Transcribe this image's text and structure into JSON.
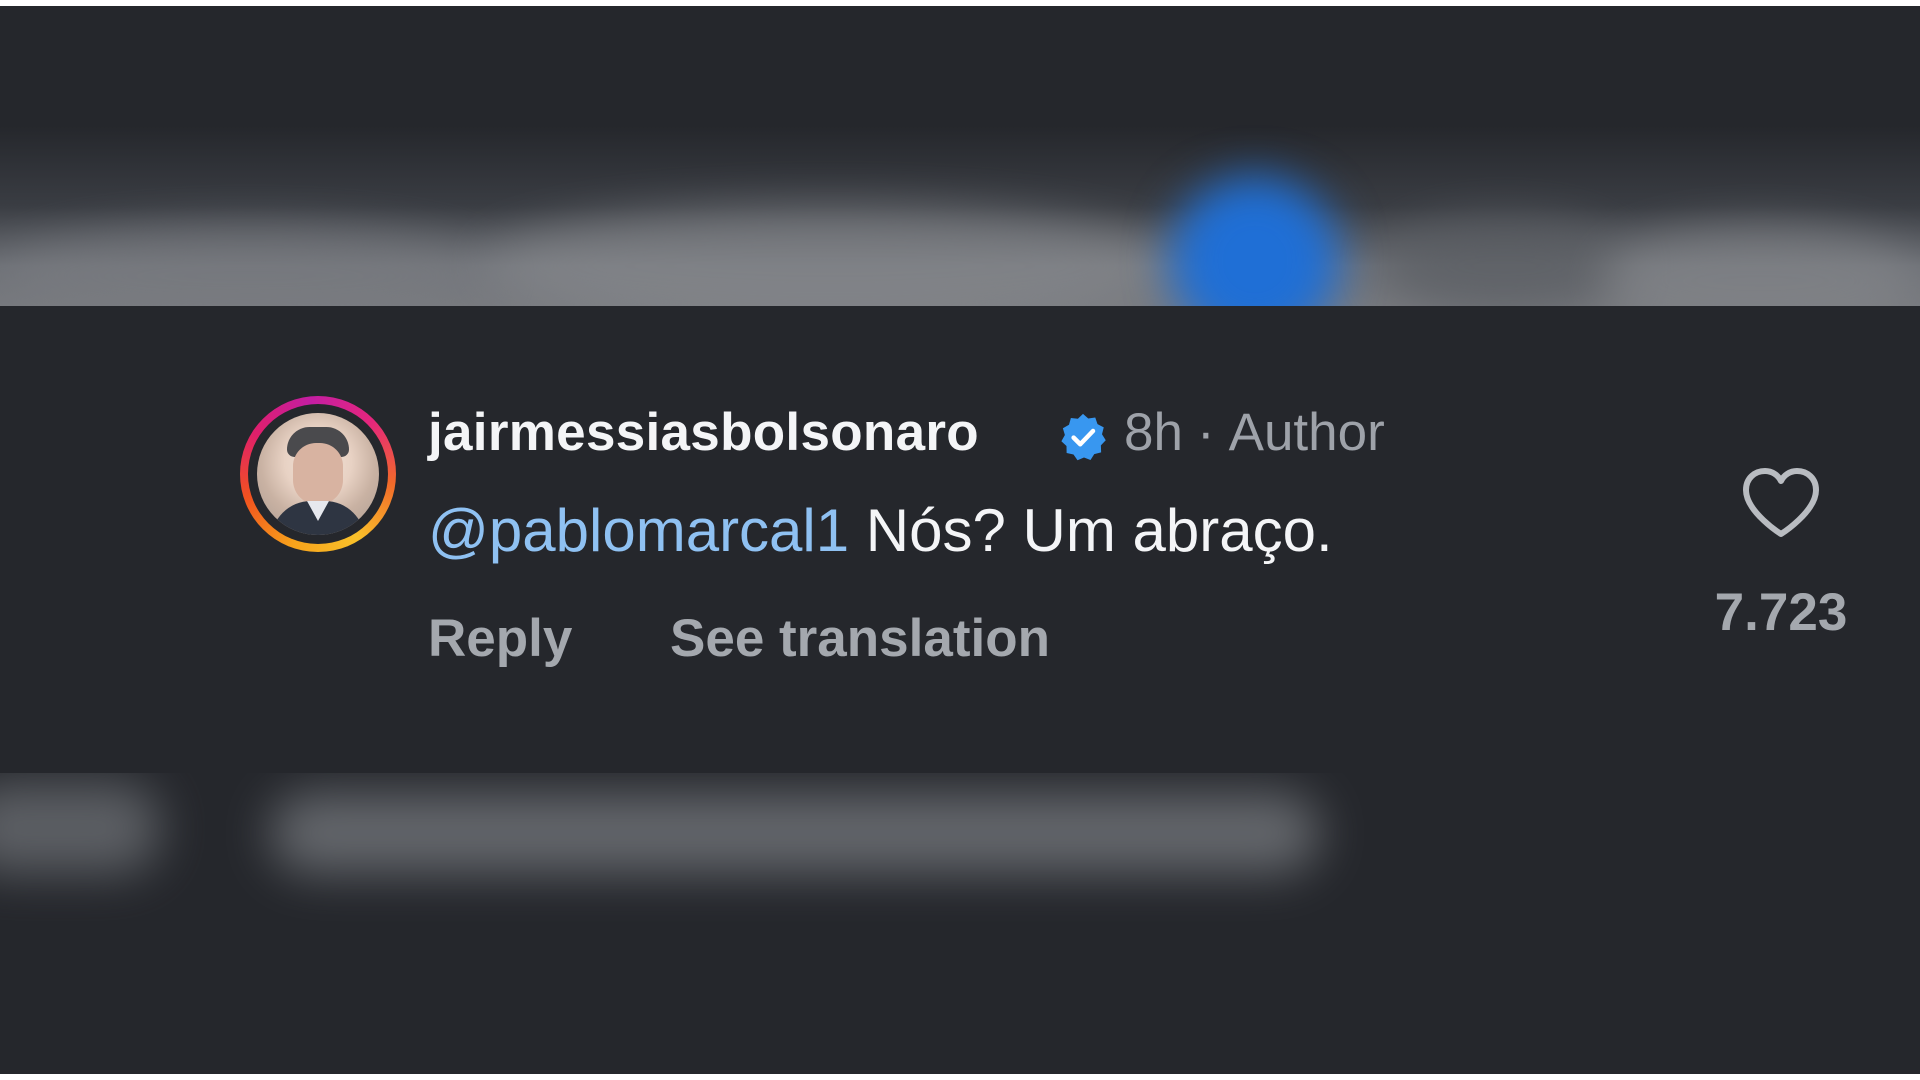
{
  "comment": {
    "username": "jairmessiasbolsonaro",
    "verified": true,
    "time": "8h",
    "separator": "·",
    "author_label": "Author",
    "mention": "@pablomarcal1",
    "text": "Nós? Um abraço.",
    "actions": {
      "reply_label": "Reply",
      "translate_label": "See translation"
    },
    "likes": {
      "count": "7.723",
      "icon": "heart-outline-icon"
    },
    "avatar": {
      "icon": "profile-photo"
    }
  },
  "colors": {
    "background": "#25272c",
    "username": "#f4f5f7",
    "mention": "#8fc1f2",
    "muted_text": "#9ea2a9",
    "verified_badge": "#3897f0",
    "story_ring": [
      "#f9c12a",
      "#f26a2a",
      "#e01f6b",
      "#c41ea3"
    ]
  }
}
